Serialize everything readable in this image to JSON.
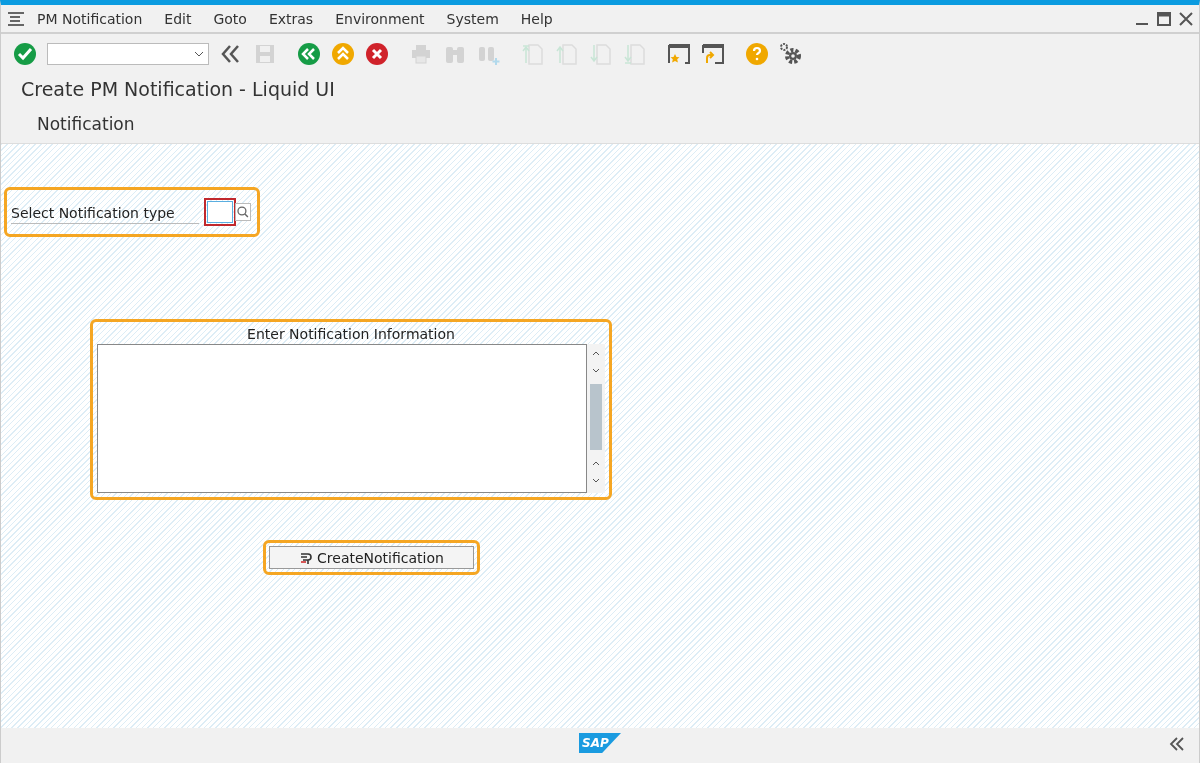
{
  "menu": [
    "PM Notification",
    "Edit",
    "Goto",
    "Extras",
    "Environment",
    "System",
    "Help"
  ],
  "toolbar": [
    {
      "kind": "enter",
      "disabled": false
    },
    {
      "kind": "command-field",
      "disabled": false
    },
    {
      "kind": "collapse",
      "disabled": false
    },
    {
      "kind": "save",
      "disabled": true
    },
    {
      "kind": "back",
      "disabled": false
    },
    {
      "kind": "exit",
      "disabled": false
    },
    {
      "kind": "cancel",
      "disabled": false
    },
    {
      "kind": "print",
      "disabled": true
    },
    {
      "kind": "find",
      "disabled": true
    },
    {
      "kind": "find-next",
      "disabled": true
    },
    {
      "kind": "first-page",
      "disabled": true
    },
    {
      "kind": "prev-page",
      "disabled": true
    },
    {
      "kind": "next-page",
      "disabled": true
    },
    {
      "kind": "last-page",
      "disabled": true
    },
    {
      "kind": "new-session",
      "disabled": false
    },
    {
      "kind": "shortcut",
      "disabled": false
    },
    {
      "kind": "help",
      "disabled": false
    },
    {
      "kind": "settings",
      "disabled": false
    }
  ],
  "title": "Create PM Notification - Liquid UI",
  "app_toolbar": [
    "Notification"
  ],
  "notification_type": {
    "label": "Select Notification type"
  },
  "info_box": {
    "title": "Enter Notification Information"
  },
  "create_button": "CreateNotification",
  "status_bar": {
    "logo": "SAP"
  }
}
